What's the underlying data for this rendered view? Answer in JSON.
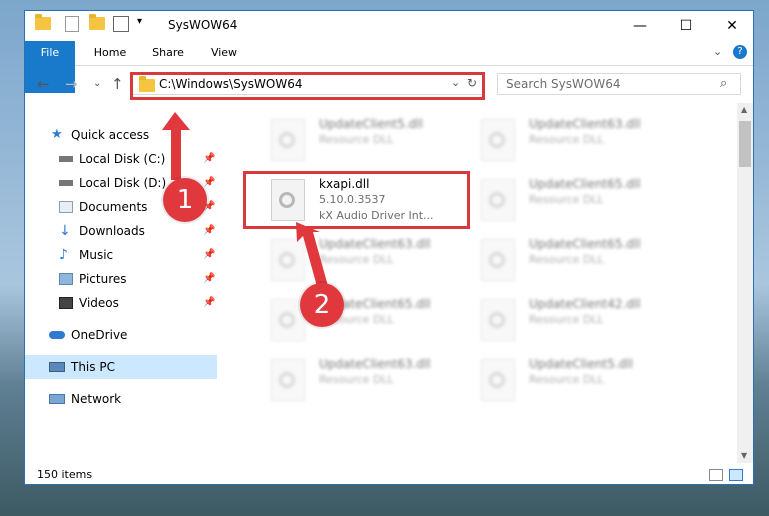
{
  "window": {
    "title": "SysWOW64"
  },
  "ribbon": {
    "tabs": [
      "File",
      "Home",
      "Share",
      "View"
    ]
  },
  "address": {
    "path": "C:\\Windows\\SysWOW64"
  },
  "search": {
    "placeholder": "Search SysWOW64"
  },
  "nav_pane": {
    "items": [
      {
        "label": "Quick access"
      },
      {
        "label": "Local Disk (C:)"
      },
      {
        "label": "Local Disk (D:)"
      },
      {
        "label": "Documents"
      },
      {
        "label": "Downloads"
      },
      {
        "label": "Music"
      },
      {
        "label": "Pictures"
      },
      {
        "label": "Videos"
      },
      {
        "label": "OneDrive"
      },
      {
        "label": "This PC"
      },
      {
        "label": "Network"
      }
    ]
  },
  "files": [
    {
      "name": "UpdateClient5.dll",
      "desc": "Resource DLL"
    },
    {
      "name": "UpdateClient63.dll",
      "desc": "Resource DLL"
    },
    {
      "name": "kxapi.dll",
      "desc": "5.10.0.3537",
      "desc2": "kX Audio Driver Int..."
    },
    {
      "name": "UpdateClient65.dll",
      "desc": "Resource DLL"
    },
    {
      "name": "UpdateClient63.dll",
      "desc": "Resource DLL"
    },
    {
      "name": "UpdateClient65.dll",
      "desc": "Resource DLL"
    },
    {
      "name": "UpdateClient65.dll",
      "desc": "Resource DLL"
    },
    {
      "name": "UpdateClient42.dll",
      "desc": "Resource DLL"
    },
    {
      "name": "UpdateClient63.dll",
      "desc": "Resource DLL"
    },
    {
      "name": "UpdateClient5.dll",
      "desc": "Resource DLL"
    }
  ],
  "status": {
    "items_count": "150 items"
  },
  "badges": {
    "one": "1",
    "two": "2"
  },
  "colors": {
    "accent": "#1979ca",
    "highlight": "#d9383d",
    "selected": "#cce8ff"
  },
  "icons": [
    "folder-icon",
    "back-arrow-icon",
    "forward-arrow-icon",
    "up-arrow-icon",
    "refresh-icon",
    "search-icon",
    "dropdown-icon",
    "pin-icon",
    "dll-file-icon",
    "help-icon"
  ]
}
